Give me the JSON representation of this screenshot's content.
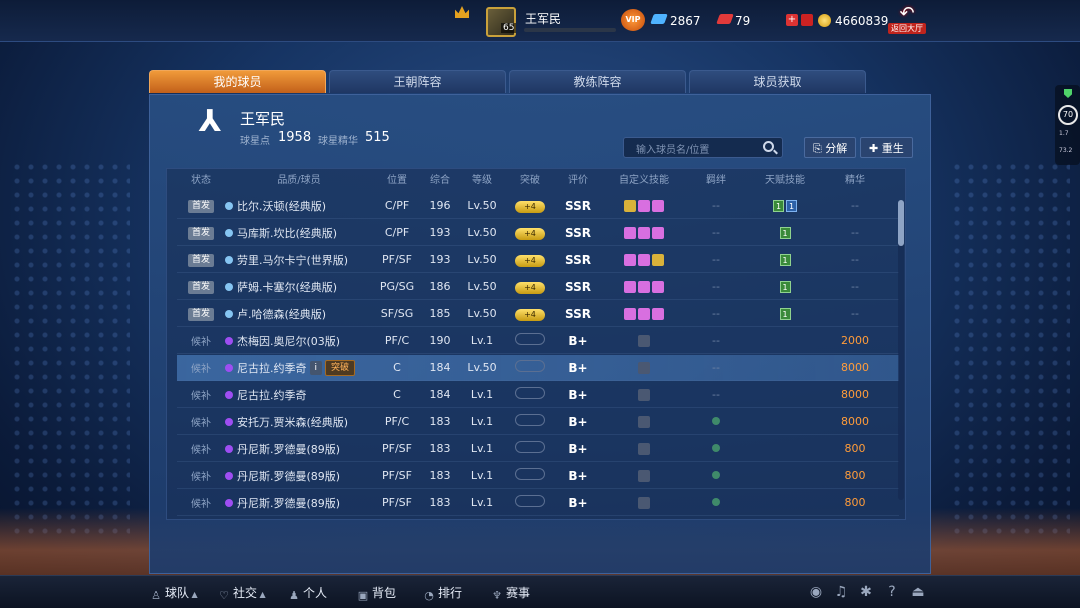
{
  "topbar": {
    "player_name": "王军民",
    "level": "65",
    "vip": "VIP",
    "gems": "2867",
    "tickets": "79",
    "coins": "4660839",
    "back_label": "返回大厅"
  },
  "tabs": [
    {
      "label": "我的球员",
      "active": true
    },
    {
      "label": "王朝阵容",
      "active": false
    },
    {
      "label": "教练阵容",
      "active": false
    },
    {
      "label": "球员获取",
      "active": false
    }
  ],
  "owner": {
    "name": "王军民",
    "star_points_label": "球星点",
    "star_points": "1958",
    "essence_label": "球星精华",
    "essence": "515"
  },
  "search": {
    "placeholder": "输入球员名/位置"
  },
  "actions": {
    "decompose": "分解",
    "rebirth": "重生"
  },
  "table": {
    "headers": [
      "状态",
      "品质/球员",
      "位置",
      "综合",
      "等级",
      "突破",
      "评价",
      "自定义技能",
      "羁绊",
      "天赋技能",
      "精华"
    ],
    "rows": [
      {
        "status": "首发",
        "starter": true,
        "color": "blue",
        "name": "比尔.沃顿(经典版)",
        "position": "C/PF",
        "overall": "196",
        "level": "Lv.50",
        "breakthrough": "+4",
        "rating": "SSR",
        "skills": [
          "gold",
          "pink",
          "pink"
        ],
        "fetter": "--",
        "talent": [
          "1",
          "1"
        ],
        "essence": "--"
      },
      {
        "status": "首发",
        "starter": true,
        "color": "blue",
        "name": "马库斯.坎比(经典版)",
        "position": "C/PF",
        "overall": "193",
        "level": "Lv.50",
        "breakthrough": "+4",
        "rating": "SSR",
        "skills": [
          "pink",
          "pink",
          "pink"
        ],
        "fetter": "--",
        "talent": [
          "1"
        ],
        "essence": "--"
      },
      {
        "status": "首发",
        "starter": true,
        "color": "blue",
        "name": "劳里.马尔卡宁(世界版)",
        "position": "PF/SF",
        "overall": "193",
        "level": "Lv.50",
        "breakthrough": "+4",
        "rating": "SSR",
        "skills": [
          "pink",
          "pink",
          "gold"
        ],
        "fetter": "--",
        "talent": [
          "1"
        ],
        "essence": "--"
      },
      {
        "status": "首发",
        "starter": true,
        "color": "blue",
        "name": "萨姆.卡塞尔(经典版)",
        "position": "PG/SG",
        "overall": "186",
        "level": "Lv.50",
        "breakthrough": "+4",
        "rating": "SSR",
        "skills": [
          "pink",
          "pink",
          "pink"
        ],
        "fetter": "--",
        "talent": [
          "1"
        ],
        "essence": "--"
      },
      {
        "status": "首发",
        "starter": true,
        "color": "blue",
        "name": "卢.哈德森(经典版)",
        "position": "SF/SG",
        "overall": "185",
        "level": "Lv.50",
        "breakthrough": "+4",
        "rating": "SSR",
        "skills": [
          "pink",
          "pink",
          "pink"
        ],
        "fetter": "--",
        "talent": [
          "1"
        ],
        "essence": "--"
      },
      {
        "status": "候补",
        "starter": false,
        "color": "purple",
        "name": "杰梅因.奥尼尔(03版)",
        "position": "PF/C",
        "overall": "190",
        "level": "Lv.1",
        "breakthrough": "",
        "rating": "B+",
        "skills": [
          "lock"
        ],
        "fetter": "--",
        "talent": [],
        "essence": "2000"
      },
      {
        "status": "候补",
        "starter": false,
        "color": "purple",
        "name": "尼古拉.约季奇",
        "position": "C",
        "overall": "184",
        "level": "Lv.50",
        "breakthrough": "",
        "rating": "B+",
        "skills": [
          "lock"
        ],
        "fetter": "--",
        "talent": [],
        "essence": "8000",
        "selected": true,
        "info_label": "i",
        "break_label": "突破"
      },
      {
        "status": "候补",
        "starter": false,
        "color": "purple",
        "name": "尼古拉.约季奇",
        "position": "C",
        "overall": "184",
        "level": "Lv.1",
        "breakthrough": "",
        "rating": "B+",
        "skills": [
          "lock"
        ],
        "fetter": "--",
        "talent": [],
        "essence": "8000"
      },
      {
        "status": "候补",
        "starter": false,
        "color": "purple",
        "name": "安托万.贾米森(经典版)",
        "position": "PF/C",
        "overall": "183",
        "level": "Lv.1",
        "breakthrough": "",
        "rating": "B+",
        "skills": [
          "lock"
        ],
        "fetter": "icon",
        "talent": [],
        "essence": "8000"
      },
      {
        "status": "候补",
        "starter": false,
        "color": "purple",
        "name": "丹尼斯.罗德曼(89版)",
        "position": "PF/SF",
        "overall": "183",
        "level": "Lv.1",
        "breakthrough": "",
        "rating": "B+",
        "skills": [
          "lock"
        ],
        "fetter": "icon",
        "talent": [],
        "essence": "800"
      },
      {
        "status": "候补",
        "starter": false,
        "color": "purple",
        "name": "丹尼斯.罗德曼(89版)",
        "position": "PF/SF",
        "overall": "183",
        "level": "Lv.1",
        "breakthrough": "",
        "rating": "B+",
        "skills": [
          "lock"
        ],
        "fetter": "icon",
        "talent": [],
        "essence": "800"
      },
      {
        "status": "候补",
        "starter": false,
        "color": "purple",
        "name": "丹尼斯.罗德曼(89版)",
        "position": "PF/SF",
        "overall": "183",
        "level": "Lv.1",
        "breakthrough": "",
        "rating": "B+",
        "skills": [
          "lock"
        ],
        "fetter": "icon",
        "talent": [],
        "essence": "800"
      }
    ]
  },
  "side_meters": {
    "score": "70",
    "line1": "1.7",
    "line2": "73.2"
  },
  "bottom_nav": [
    {
      "label": "球队",
      "icon": "person-icon"
    },
    {
      "label": "社交",
      "icon": "heart-icon"
    },
    {
      "label": "个人",
      "icon": "user-icon"
    },
    {
      "label": "背包",
      "icon": "bag-icon"
    },
    {
      "label": "排行",
      "icon": "rank-icon"
    },
    {
      "label": "赛事",
      "icon": "trophy-icon"
    }
  ],
  "colors": {
    "accent": "#f09a3a",
    "essence": "#ff9c3a",
    "panel": "#284e82"
  }
}
